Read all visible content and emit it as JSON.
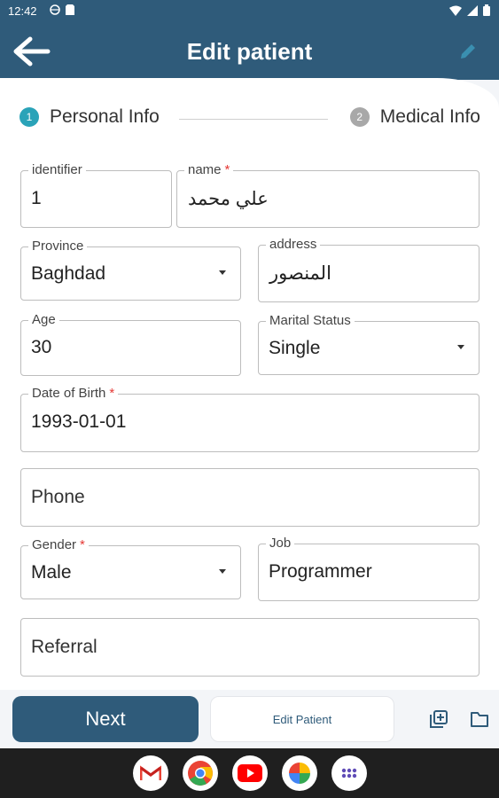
{
  "status_bar": {
    "time": "12:42"
  },
  "header": {
    "title": "Edit patient"
  },
  "stepper": {
    "steps": [
      {
        "num": "1",
        "label": "Personal Info"
      },
      {
        "num": "2",
        "label": "Medical Info"
      }
    ]
  },
  "form": {
    "identifier": {
      "label": "identifier",
      "value": "1"
    },
    "name": {
      "label": "name",
      "required": "*",
      "value": "علي محمد"
    },
    "province": {
      "label": "Province",
      "value": "Baghdad"
    },
    "address": {
      "label": "address",
      "value": "المنصور"
    },
    "age": {
      "label": "Age",
      "value": "30"
    },
    "marital_status": {
      "label": "Marital Status",
      "value": "Single"
    },
    "dob": {
      "label": "Date of Birth",
      "required": "*",
      "value": "1993-01-01"
    },
    "phone": {
      "placeholder": "Phone"
    },
    "gender": {
      "label": "Gender",
      "required": "*",
      "value": "Male"
    },
    "job": {
      "label": "Job",
      "value": "Programmer"
    },
    "referral": {
      "placeholder": "Referral"
    }
  },
  "actions": {
    "next_label": "Next",
    "tab_label": "Edit Patient"
  },
  "colors": {
    "primary": "#2f5b7a",
    "step_active": "#2aa3b8",
    "required": "#e53935"
  }
}
